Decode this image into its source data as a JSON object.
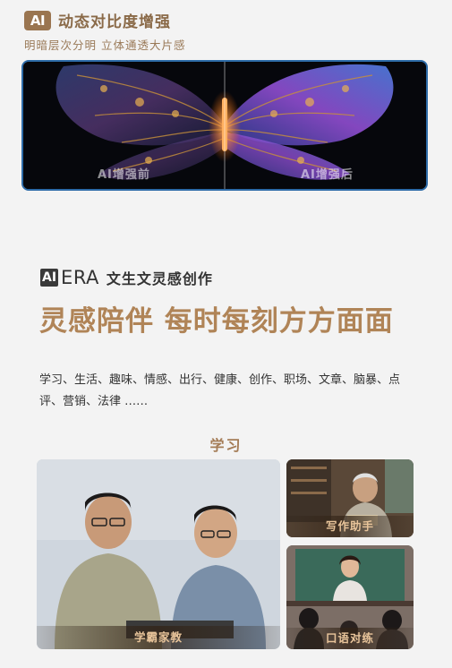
{
  "section1": {
    "badge": "AI",
    "title": "动态对比度增强",
    "subtitle": "明暗层次分明 立体通透大片感",
    "before_label": "AI增强前",
    "after_label": "AI增强后"
  },
  "section2": {
    "badge": "AI",
    "era": "ERA",
    "title": "文生文灵感创作",
    "headline": "灵感陪伴 每时每刻方方面面",
    "topics": "学习、生活、趣味、情感、出行、健康、创作、职场、文章、脑暴、点评、营销、法律 ……",
    "category": "学习"
  },
  "cards": {
    "main_caption": "学霸家教",
    "top_right_caption": "写作助手",
    "bottom_right_caption": "口语对练"
  },
  "colors": {
    "accent": "#b08457",
    "badge": "#9a7550",
    "compare_border": "#2d6ba8"
  }
}
